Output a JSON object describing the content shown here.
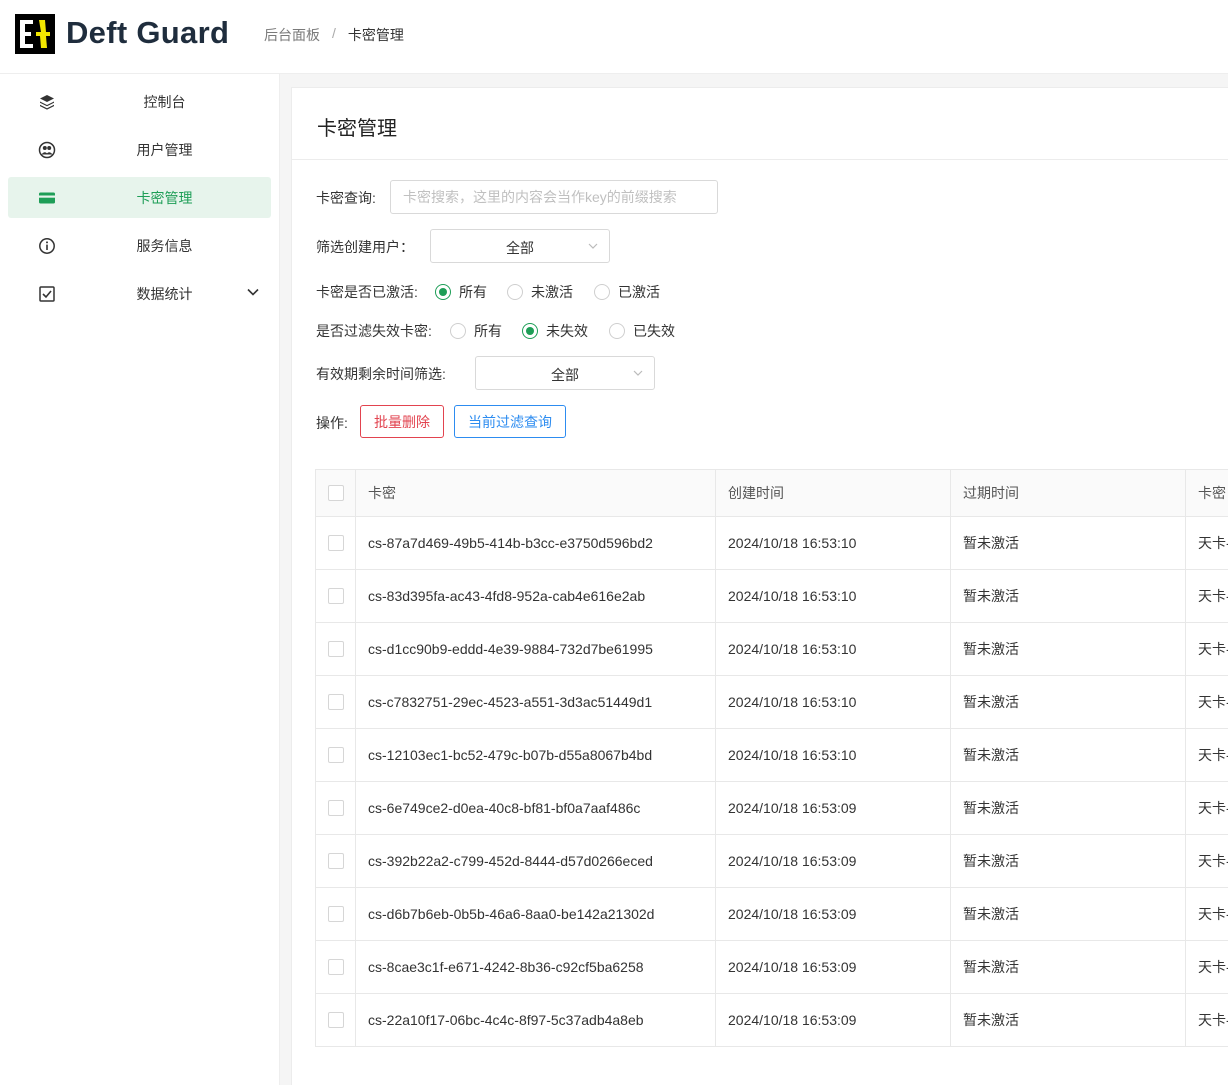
{
  "header": {
    "brand": "Deft Guard",
    "breadcrumb": [
      "后台面板",
      "卡密管理"
    ],
    "breadcrumb_sep": "/"
  },
  "sidebar": {
    "items": [
      {
        "label": "控制台",
        "icon": "layers-icon",
        "active": false
      },
      {
        "label": "用户管理",
        "icon": "users-icon",
        "active": false
      },
      {
        "label": "卡密管理",
        "icon": "credit-card-icon",
        "active": true
      },
      {
        "label": "服务信息",
        "icon": "info-icon",
        "active": false
      },
      {
        "label": "数据统计",
        "icon": "checkbox-icon",
        "active": false,
        "expandable": true
      }
    ]
  },
  "page": {
    "title": "卡密管理",
    "search": {
      "label": "卡密查询:",
      "placeholder": "卡密搜索，这里的内容会当作key的前缀搜索",
      "value": ""
    },
    "creator_filter": {
      "label": "筛选创建用户：",
      "value": "全部"
    },
    "activated_filter": {
      "label": "卡密是否已激活:",
      "options": [
        "所有",
        "未激活",
        "已激活"
      ],
      "selected": "所有"
    },
    "expired_filter": {
      "label": "是否过滤失效卡密:",
      "options": [
        "所有",
        "未失效",
        "已失效"
      ],
      "selected": "未失效"
    },
    "remaining_filter": {
      "label": "有效期剩余时间筛选:",
      "value": "全部"
    },
    "actions": {
      "label": "操作:",
      "delete_label": "批量删除",
      "query_label": "当前过滤查询"
    }
  },
  "table": {
    "columns": [
      "卡密",
      "创建时间",
      "过期时间",
      "卡密"
    ],
    "rows": [
      {
        "key": "cs-87a7d469-49b5-414b-b3cc-e3750d596bd2",
        "created": "2024/10/18 16:53:10",
        "expires": "暂未激活",
        "type": "天卡-"
      },
      {
        "key": "cs-83d395fa-ac43-4fd8-952a-cab4e616e2ab",
        "created": "2024/10/18 16:53:10",
        "expires": "暂未激活",
        "type": "天卡-"
      },
      {
        "key": "cs-d1cc90b9-eddd-4e39-9884-732d7be61995",
        "created": "2024/10/18 16:53:10",
        "expires": "暂未激活",
        "type": "天卡-"
      },
      {
        "key": "cs-c7832751-29ec-4523-a551-3d3ac51449d1",
        "created": "2024/10/18 16:53:10",
        "expires": "暂未激活",
        "type": "天卡-"
      },
      {
        "key": "cs-12103ec1-bc52-479c-b07b-d55a8067b4bd",
        "created": "2024/10/18 16:53:10",
        "expires": "暂未激活",
        "type": "天卡-"
      },
      {
        "key": "cs-6e749ce2-d0ea-40c8-bf81-bf0a7aaf486c",
        "created": "2024/10/18 16:53:09",
        "expires": "暂未激活",
        "type": "天卡-"
      },
      {
        "key": "cs-392b22a2-c799-452d-8444-d57d0266eced",
        "created": "2024/10/18 16:53:09",
        "expires": "暂未激活",
        "type": "天卡-"
      },
      {
        "key": "cs-d6b7b6eb-0b5b-46a6-8aa0-be142a21302d",
        "created": "2024/10/18 16:53:09",
        "expires": "暂未激活",
        "type": "天卡-"
      },
      {
        "key": "cs-8cae3c1f-e671-4242-8b36-c92cf5ba6258",
        "created": "2024/10/18 16:53:09",
        "expires": "暂未激活",
        "type": "天卡-"
      },
      {
        "key": "cs-22a10f17-06bc-4c4c-8f97-5c37adb4a8eb",
        "created": "2024/10/18 16:53:09",
        "expires": "暂未激活",
        "type": "天卡-"
      }
    ]
  },
  "colors": {
    "accent": "#1e9e57",
    "danger": "#e2434f",
    "primary": "#2d8cf0",
    "active_bg": "#e7f4ec"
  }
}
